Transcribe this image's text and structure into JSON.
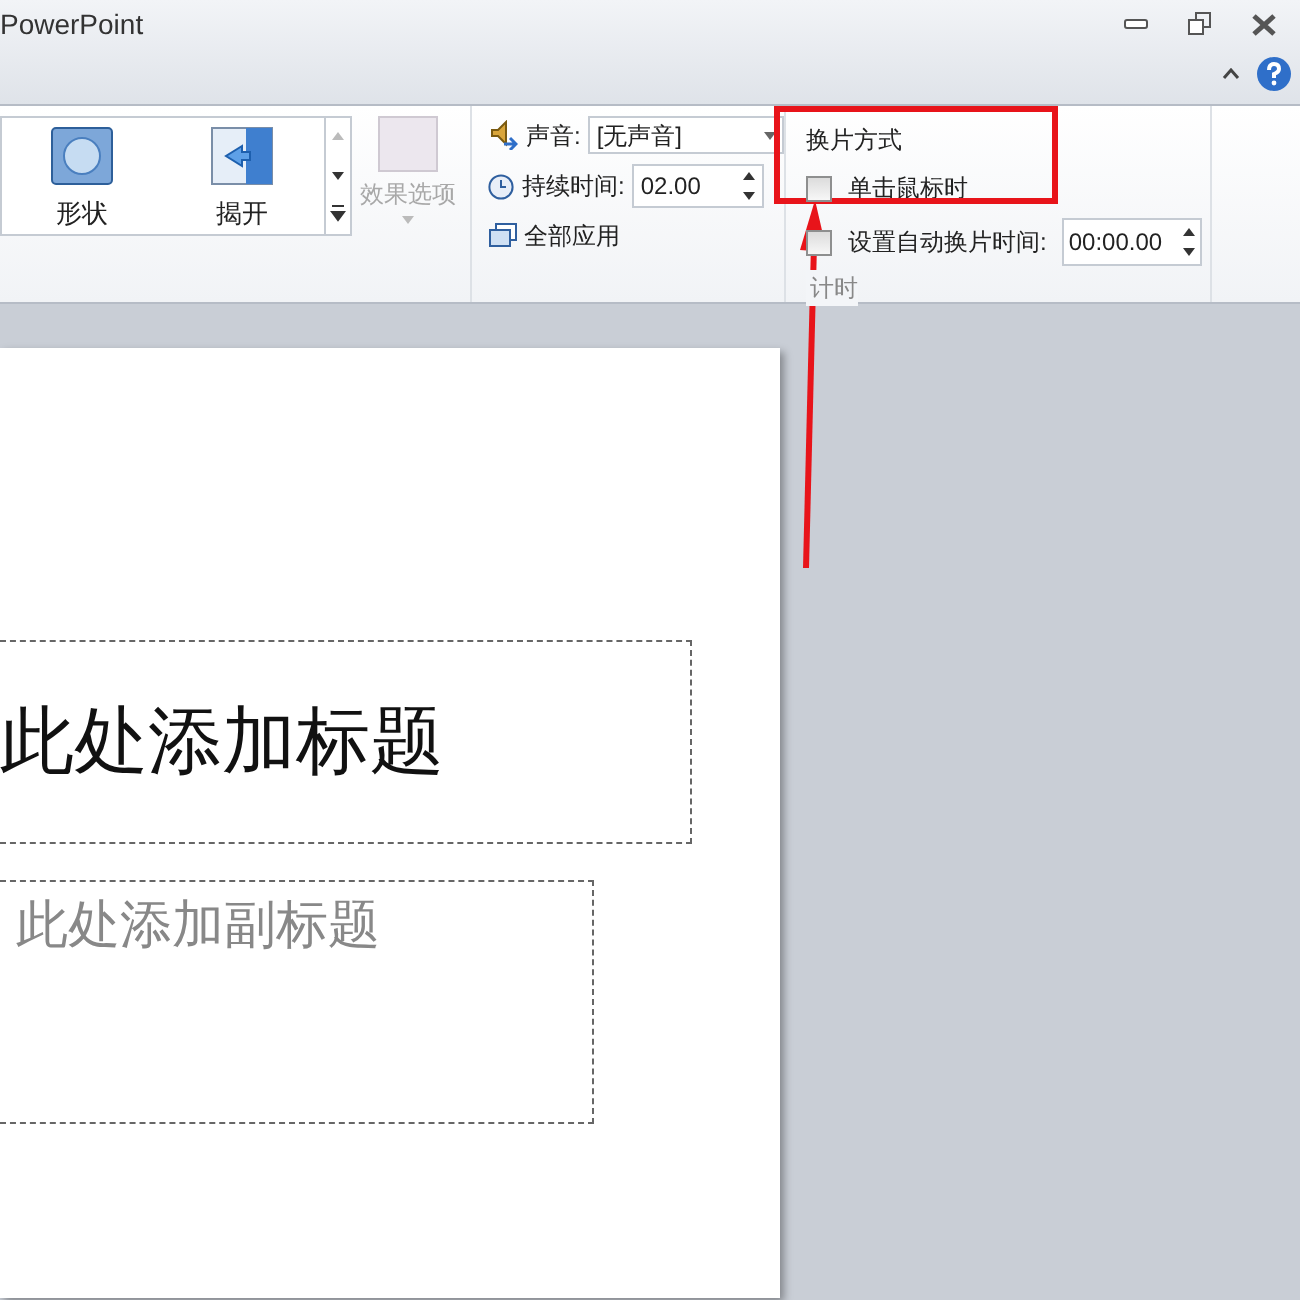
{
  "window": {
    "title": "PowerPoint"
  },
  "ribbon": {
    "transitions": [
      {
        "label": "形状",
        "kind": "shape"
      },
      {
        "label": "揭开",
        "kind": "uncover"
      }
    ],
    "effect_options": {
      "label": "效果选项",
      "disabled": true
    },
    "sound": {
      "label": "声音:",
      "value": "[无声音]"
    },
    "duration": {
      "label": "持续时间:",
      "value": "02.00"
    },
    "apply_all": "全部应用",
    "advance": {
      "title": "换片方式",
      "options": [
        {
          "label": "单击鼠标时",
          "checked": false
        },
        {
          "label": "设置自动换片时间:",
          "checked": false
        }
      ],
      "time": "00:00.00"
    },
    "group_label": "计时"
  },
  "slide": {
    "title": "此处添加标题",
    "subtitle": "此处添加副标题"
  }
}
